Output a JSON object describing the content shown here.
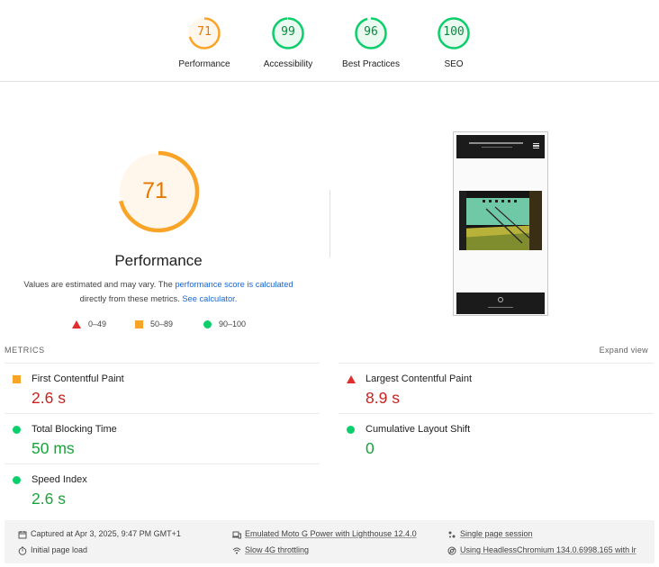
{
  "summary_gauges": [
    {
      "score": "71",
      "label": "Performance",
      "color": "#f9a427",
      "fraction": 0.71
    },
    {
      "score": "99",
      "label": "Accessibility",
      "color": "#0cce6b",
      "fraction": 0.99
    },
    {
      "score": "96",
      "label": "Best Practices",
      "color": "#0cce6b",
      "fraction": 0.96
    },
    {
      "score": "100",
      "label": "SEO",
      "color": "#0cce6b",
      "fraction": 1.0
    }
  ],
  "performance": {
    "score": "71",
    "fraction": 0.71,
    "title": "Performance",
    "desc_prefix": "Values are estimated and may vary. The ",
    "desc_link1": "performance score is calculated",
    "desc_mid": " directly from these metrics. ",
    "desc_link2": "See calculator."
  },
  "legend": [
    {
      "shape": "triangle",
      "range": "0–49",
      "color": "#e02d2d"
    },
    {
      "shape": "square",
      "range": "50–89",
      "color": "#f9a427"
    },
    {
      "shape": "circle",
      "range": "90–100",
      "color": "#0cce6b"
    }
  ],
  "metrics": {
    "header": "METRICS",
    "expand_label": "Expand view",
    "items": [
      {
        "name": "First Contentful Paint",
        "value": "2.6 s",
        "rating": "average"
      },
      {
        "name": "Largest Contentful Paint",
        "value": "8.9 s",
        "rating": "fail"
      },
      {
        "name": "Total Blocking Time",
        "value": "50 ms",
        "rating": "pass"
      },
      {
        "name": "Cumulative Layout Shift",
        "value": "0",
        "rating": "pass"
      },
      {
        "name": "Speed Index",
        "value": "2.6 s",
        "rating": "pass"
      }
    ]
  },
  "footer": {
    "captured": "Captured at Apr 3, 2025, 9:47 PM GMT+1",
    "device": "Emulated Moto G Power with Lighthouse 12.4.0",
    "session": "Single page session",
    "load": "Initial page load",
    "throttling": "Slow 4G throttling",
    "browser": "Using HeadlessChromium 134.0.6998.165 with lr"
  },
  "colors": {
    "fail": "#c5221f",
    "average": "#e67700",
    "pass": "#18a33a",
    "link": "#1967d2"
  }
}
